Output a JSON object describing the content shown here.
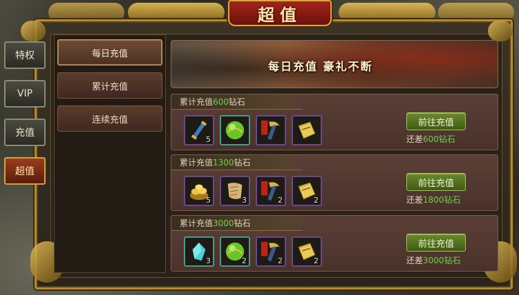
{
  "title": "超值",
  "side_tabs": [
    {
      "label": "特权",
      "active": false
    },
    {
      "label": "VIP",
      "active": false
    },
    {
      "label": "充值",
      "active": false
    },
    {
      "label": "超值",
      "active": true
    }
  ],
  "submenu": [
    {
      "label": "每日充值",
      "active": true
    },
    {
      "label": "累计充值",
      "active": false
    },
    {
      "label": "连续充值",
      "active": false
    }
  ],
  "banner_text": "每日充值 豪礼不断",
  "tiers": [
    {
      "head_prefix": "累计充值",
      "amount": "600",
      "head_suffix": "钻石",
      "button": "前往充值",
      "diff_prefix": "还差",
      "diff_amount": "600",
      "diff_suffix": "钻石",
      "items": [
        {
          "icon": "scroll-icon",
          "qty": "5"
        },
        {
          "icon": "green-orb-icon",
          "qty": ""
        },
        {
          "icon": "inner-skill-scroll-icon",
          "qty": ""
        },
        {
          "icon": "book-icon",
          "qty": ""
        }
      ]
    },
    {
      "head_prefix": "累计充值",
      "amount": "1300",
      "head_suffix": "钻石",
      "button": "前往充值",
      "diff_prefix": "还差",
      "diff_amount": "1800",
      "diff_suffix": "钻石",
      "items": [
        {
          "icon": "gold-ingot-pile-icon",
          "qty": "5"
        },
        {
          "icon": "map-scroll-icon",
          "qty": "3"
        },
        {
          "icon": "inner-skill-scroll-icon",
          "qty": "2"
        },
        {
          "icon": "book-icon",
          "qty": "2"
        }
      ]
    },
    {
      "head_prefix": "累计充值",
      "amount": "3000",
      "head_suffix": "钻石",
      "button": "前往充值",
      "diff_prefix": "还差",
      "diff_amount": "3000",
      "diff_suffix": "钻石",
      "items": [
        {
          "icon": "crystal-icon",
          "qty": "3"
        },
        {
          "icon": "green-orb-icon",
          "qty": "2"
        },
        {
          "icon": "inner-skill-scroll-icon",
          "qty": "2"
        },
        {
          "icon": "book-icon",
          "qty": "2"
        }
      ]
    }
  ],
  "colors": {
    "accent_gold": "#d9a845",
    "amount_green": "#6ed14a",
    "title_red": "#a3241a"
  }
}
